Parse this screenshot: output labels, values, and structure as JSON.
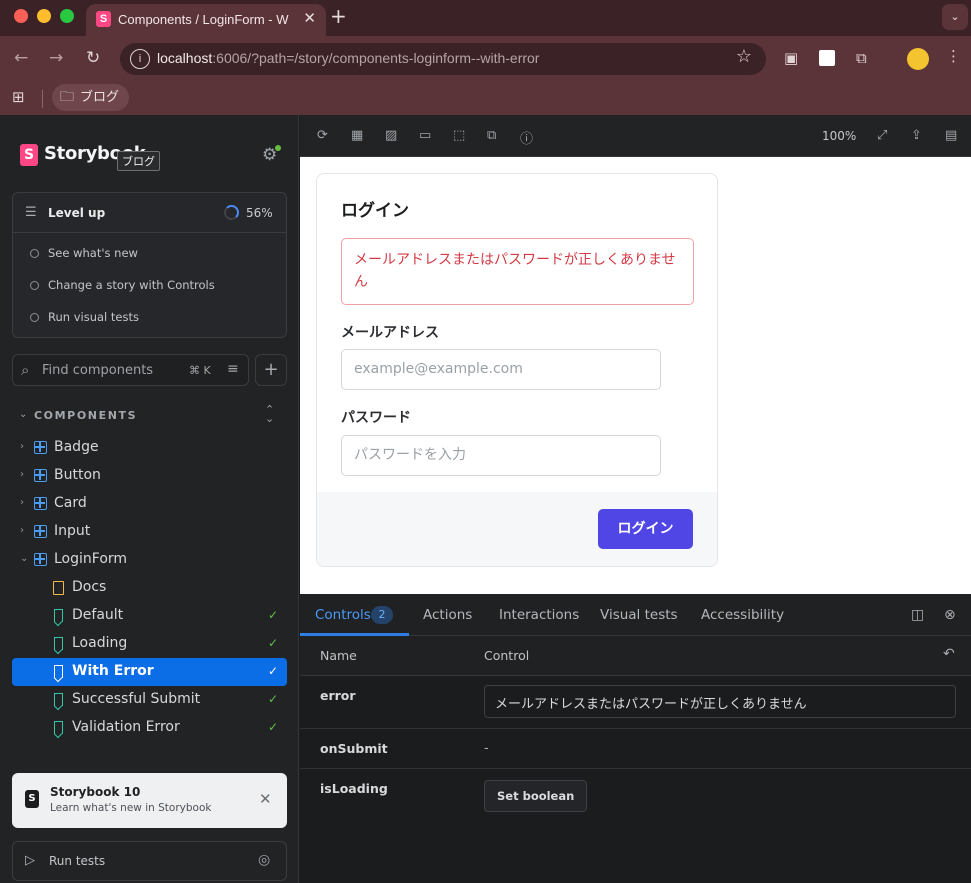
{
  "browser": {
    "tab_title": "Components / LoginForm - W",
    "tab_favicon": "S",
    "url_host": "localhost",
    "url_rest": ":6006/?path=/story/components-loginform--with-error",
    "bookmark_folder": "ブログ"
  },
  "storybook": {
    "logo": "Storybook",
    "logo_badge": "S",
    "tooltip": "ブログ",
    "level_up": {
      "title": "Level up",
      "progress": "56%",
      "progress_value": 0.56,
      "items": [
        "See what's new",
        "Change a story with Controls",
        "Run visual tests"
      ]
    },
    "search": {
      "placeholder": "Find components",
      "shortcut": "⌘ K"
    },
    "section_title": "COMPONENTS",
    "tree": [
      {
        "label": "Badge",
        "kind": "component"
      },
      {
        "label": "Button",
        "kind": "component"
      },
      {
        "label": "Card",
        "kind": "component"
      },
      {
        "label": "Input",
        "kind": "component"
      },
      {
        "label": "LoginForm",
        "kind": "component",
        "expanded": true
      },
      {
        "label": "Docs",
        "kind": "docs"
      },
      {
        "label": "Default",
        "kind": "story",
        "status": "pass"
      },
      {
        "label": "Loading",
        "kind": "story",
        "status": "pass"
      },
      {
        "label": "With Error",
        "kind": "story",
        "status": "pass",
        "selected": true
      },
      {
        "label": "Successful Submit",
        "kind": "story",
        "status": "pass"
      },
      {
        "label": "Validation Error",
        "kind": "story",
        "status": "pass"
      }
    ],
    "announcement": {
      "title": "Storybook 10",
      "subtitle": "Learn what's new in Storybook"
    },
    "run_tests": "Run tests",
    "zoom": "100%"
  },
  "preview": {
    "title": "ログイン",
    "error_message": "メールアドレスまたはパスワードが正しくありません",
    "email_label": "メールアドレス",
    "email_placeholder": "example@example.com",
    "password_label": "パスワード",
    "password_placeholder": "パスワードを入力",
    "submit_label": "ログイン"
  },
  "panel": {
    "tabs": [
      "Controls",
      "Actions",
      "Interactions",
      "Visual tests",
      "Accessibility"
    ],
    "controls_count": "2",
    "header": {
      "name": "Name",
      "control": "Control"
    },
    "rows": [
      {
        "name": "error",
        "value": "メールアドレスまたはパスワードが正しくありません"
      },
      {
        "name": "onSubmit",
        "value": "-"
      },
      {
        "name": "isLoading",
        "value": "Set boolean"
      }
    ]
  },
  "colors": {
    "accent_blue": "#0c6ee7",
    "storybook_pink": "#ff4785",
    "error_red": "#d33a44",
    "primary_button": "#4f46e5",
    "pass_green": "#5fbf4a"
  }
}
